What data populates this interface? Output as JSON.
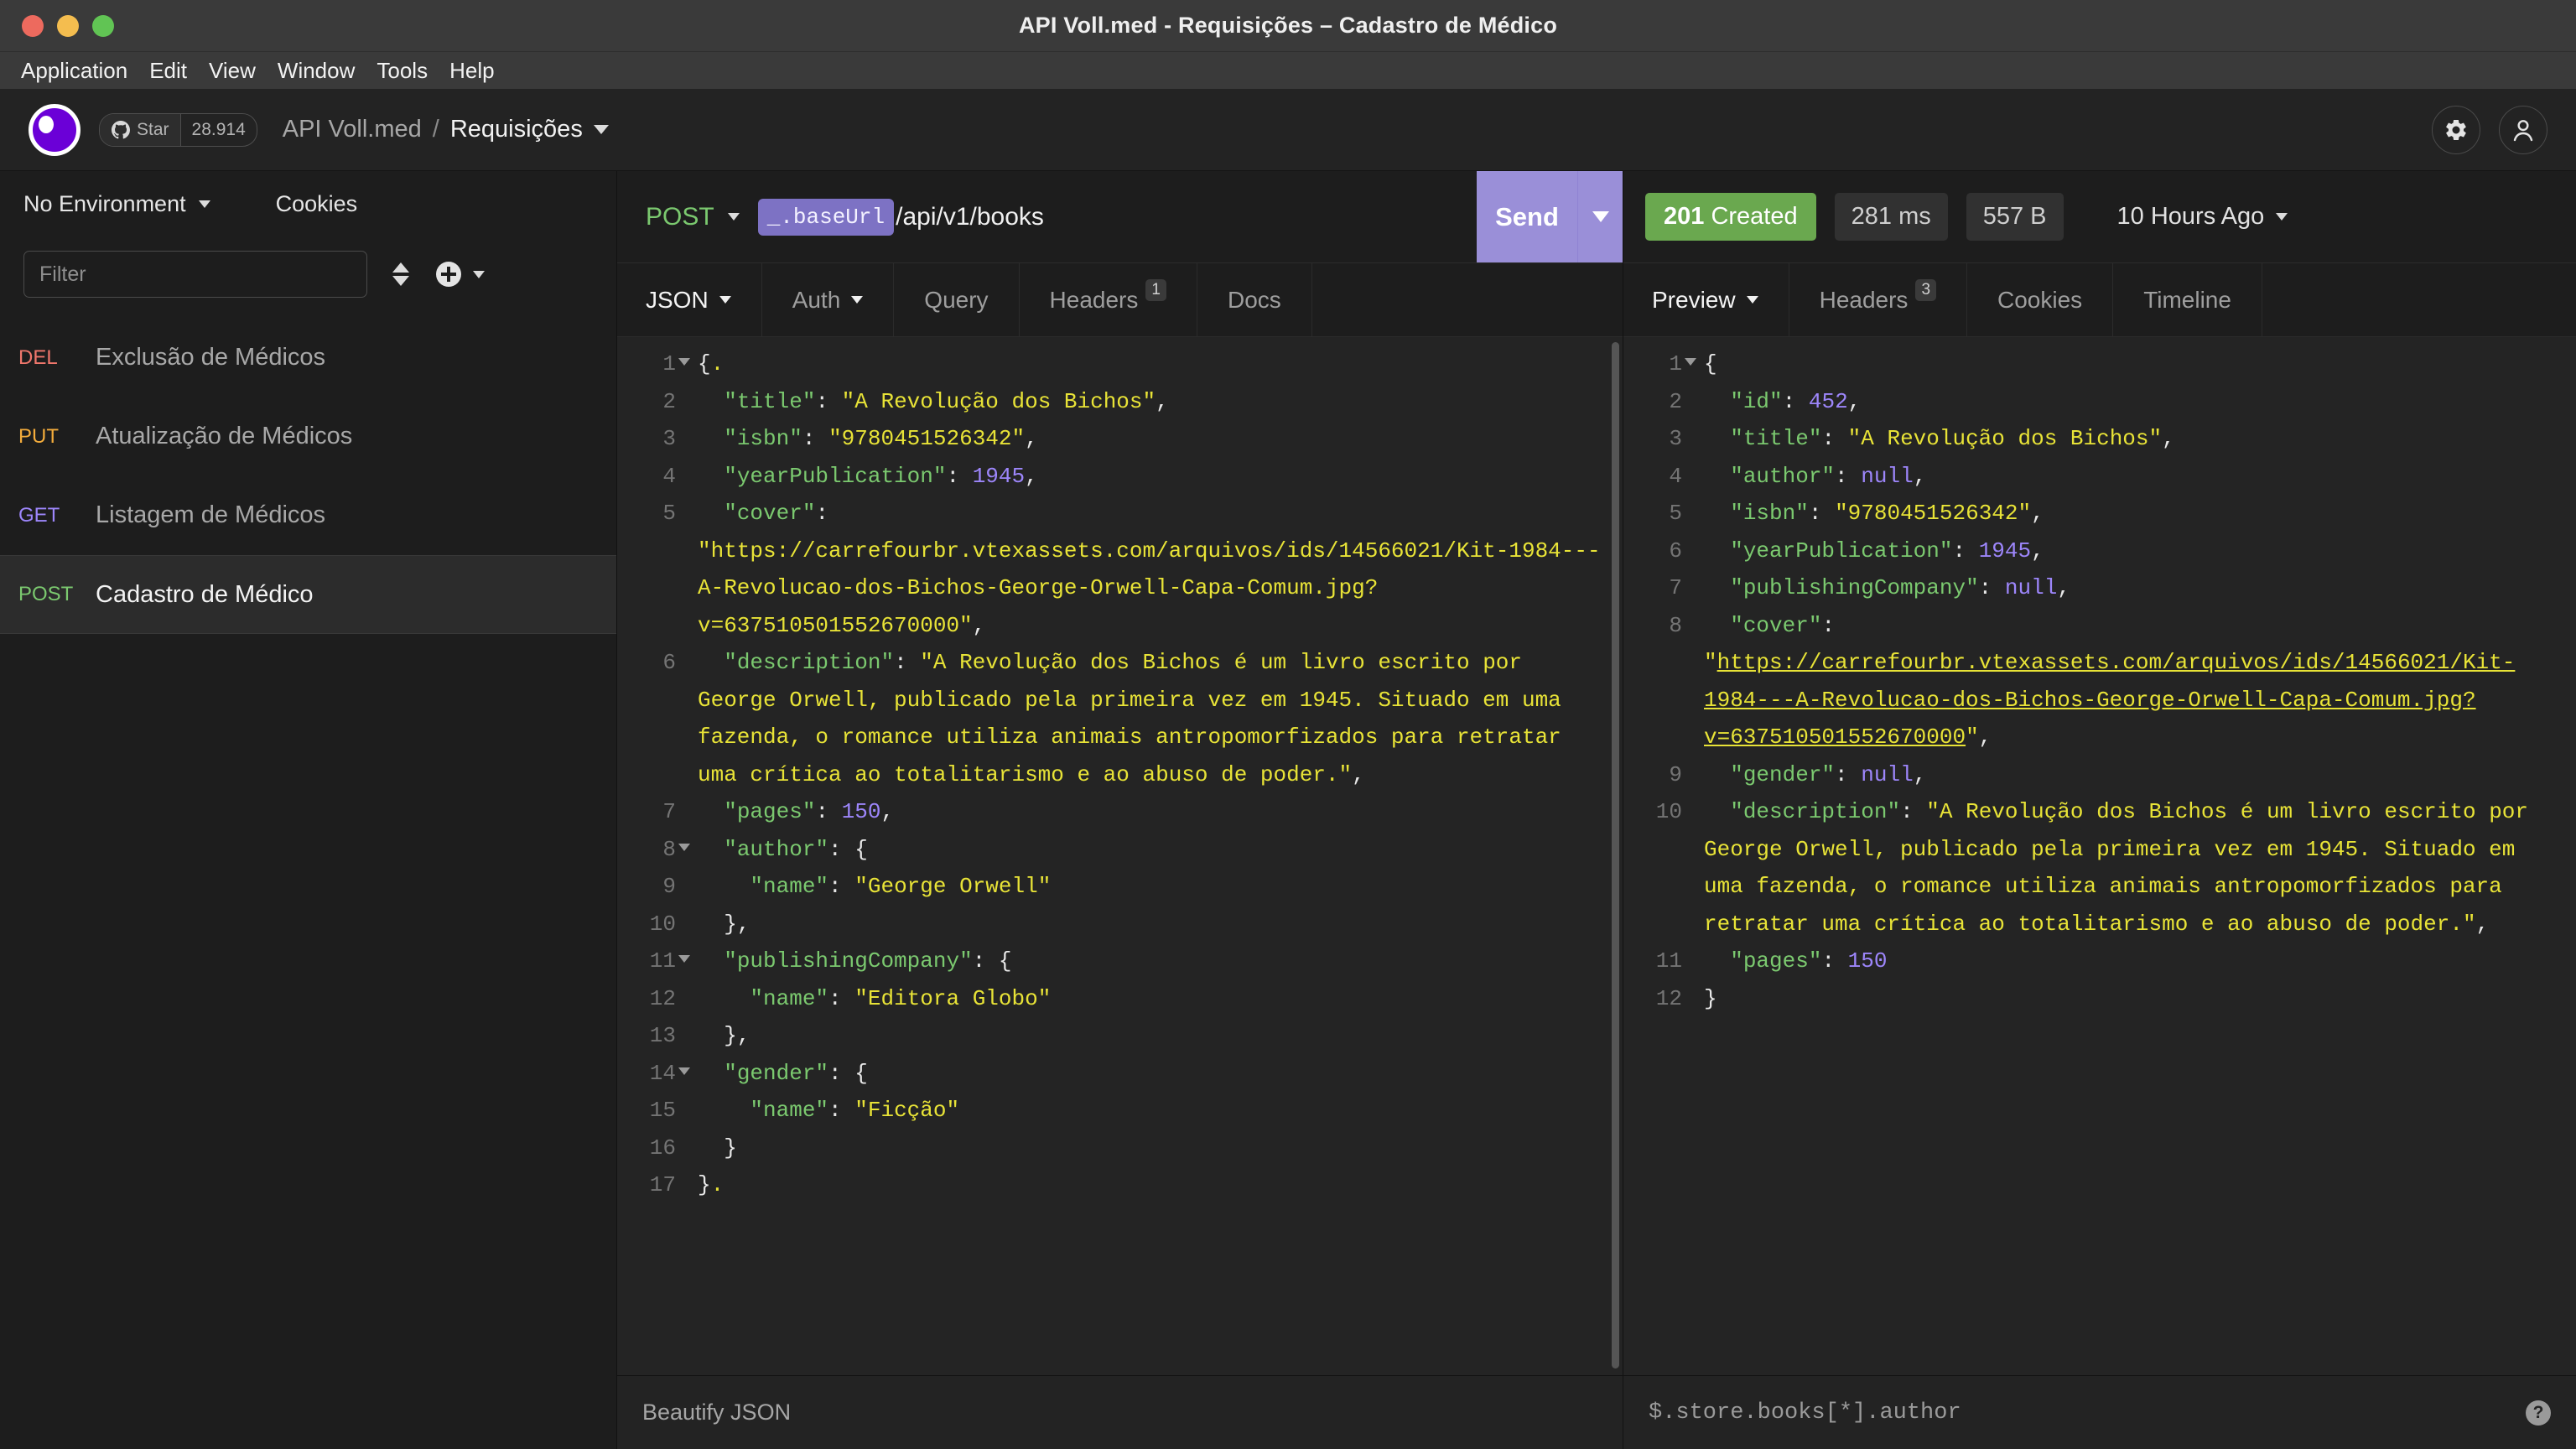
{
  "window": {
    "title": "API Voll.med - Requisições – Cadastro de Médico",
    "traffic_lights": [
      "close",
      "minimize",
      "maximize"
    ]
  },
  "menubar": {
    "items": [
      "Application",
      "Edit",
      "View",
      "Window",
      "Tools",
      "Help"
    ]
  },
  "header": {
    "star_label": "Star",
    "star_count": "28.914",
    "workspace": "API Voll.med",
    "separator": "/",
    "current": "Requisições",
    "settings_icon": "gear-icon",
    "account_icon": "user-icon"
  },
  "sidebar": {
    "environment": "No Environment",
    "cookies": "Cookies",
    "filter_placeholder": "Filter",
    "requests": [
      {
        "method": "DEL",
        "name": "Exclusão de Médicos",
        "active": false
      },
      {
        "method": "PUT",
        "name": "Atualização de Médicos",
        "active": false
      },
      {
        "method": "GET",
        "name": "Listagem de Médicos",
        "active": false
      },
      {
        "method": "POST",
        "name": "Cadastro de Médico",
        "active": true
      }
    ]
  },
  "request": {
    "method": "POST",
    "url_variable": "_.baseUrl",
    "url_path": "/api/v1/books",
    "send_label": "Send",
    "tabs": [
      {
        "label": "JSON",
        "caret": true,
        "badge": "",
        "selected": true
      },
      {
        "label": "Auth",
        "caret": true,
        "badge": "",
        "selected": false
      },
      {
        "label": "Query",
        "caret": false,
        "badge": "",
        "selected": false
      },
      {
        "label": "Headers",
        "caret": false,
        "badge": "1",
        "selected": false
      },
      {
        "label": "Docs",
        "caret": false,
        "badge": "",
        "selected": false
      }
    ],
    "footer_action": "Beautify JSON",
    "body_lines": [
      {
        "n": "1",
        "fold": true,
        "html": "<span class=\"p\">{</span><span class=\"caretpt\">.</span>"
      },
      {
        "n": "2",
        "fold": false,
        "html": "&nbsp;&nbsp;<span class=\"k\">\"title\"</span><span class=\"p\">:</span> <span class=\"s\">\"A Revolução dos Bichos\"</span><span class=\"p\">,</span>"
      },
      {
        "n": "3",
        "fold": false,
        "html": "&nbsp;&nbsp;<span class=\"k\">\"isbn\"</span><span class=\"p\">:</span> <span class=\"s\">\"9780451526342\"</span><span class=\"p\">,</span>"
      },
      {
        "n": "4",
        "fold": false,
        "html": "&nbsp;&nbsp;<span class=\"k\">\"yearPublication\"</span><span class=\"p\">:</span> <span class=\"n\">1945</span><span class=\"p\">,</span>"
      },
      {
        "n": "5",
        "fold": false,
        "html": "&nbsp;&nbsp;<span class=\"k\">\"cover\"</span><span class=\"p\">:</span> <span class=\"s\">\"https://carrefourbr.vtexassets.com/arquivos/ids/14566021/Kit-1984---A-Revolucao-dos-Bichos-George-Orwell-Capa-Comum.jpg?v=637510501552670000\"</span><span class=\"p\">,</span>"
      },
      {
        "n": "6",
        "fold": false,
        "html": "&nbsp;&nbsp;<span class=\"k\">\"description\"</span><span class=\"p\">:</span> <span class=\"s\">\"A Revolução dos Bichos é um livro escrito por George Orwell, publicado pela primeira vez em 1945. Situado em uma fazenda, o romance utiliza animais antropomorfizados para retratar uma crítica ao totalitarismo e ao abuso de poder.\"</span><span class=\"p\">,</span>"
      },
      {
        "n": "7",
        "fold": false,
        "html": "&nbsp;&nbsp;<span class=\"k\">\"pages\"</span><span class=\"p\">:</span> <span class=\"n\">150</span><span class=\"p\">,</span>"
      },
      {
        "n": "8",
        "fold": true,
        "html": "&nbsp;&nbsp;<span class=\"k\">\"author\"</span><span class=\"p\">: {</span>"
      },
      {
        "n": "9",
        "fold": false,
        "html": "&nbsp;&nbsp;&nbsp;&nbsp;<span class=\"k\">\"name\"</span><span class=\"p\">:</span> <span class=\"s\">\"George Orwell\"</span>"
      },
      {
        "n": "10",
        "fold": false,
        "html": "&nbsp;&nbsp;<span class=\"p\">},</span>"
      },
      {
        "n": "11",
        "fold": true,
        "html": "&nbsp;&nbsp;<span class=\"k\">\"publishingCompany\"</span><span class=\"p\">: {</span>"
      },
      {
        "n": "12",
        "fold": false,
        "html": "&nbsp;&nbsp;&nbsp;&nbsp;<span class=\"k\">\"name\"</span><span class=\"p\">:</span> <span class=\"s\">\"Editora Globo\"</span>"
      },
      {
        "n": "13",
        "fold": false,
        "html": "&nbsp;&nbsp;<span class=\"p\">},</span>"
      },
      {
        "n": "14",
        "fold": true,
        "html": "&nbsp;&nbsp;<span class=\"k\">\"gender\"</span><span class=\"p\">: {</span>"
      },
      {
        "n": "15",
        "fold": false,
        "html": "&nbsp;&nbsp;&nbsp;&nbsp;<span class=\"k\">\"name\"</span><span class=\"p\">:</span> <span class=\"s\">\"Ficção\"</span>"
      },
      {
        "n": "16",
        "fold": false,
        "html": "&nbsp;&nbsp;<span class=\"p\">}</span>"
      },
      {
        "n": "17",
        "fold": false,
        "html": "<span class=\"p\">}</span><span class=\"caretpt\">.</span>"
      }
    ],
    "body_json": {
      "title": "A Revolução dos Bichos",
      "isbn": "9780451526342",
      "yearPublication": 1945,
      "cover": "https://carrefourbr.vtexassets.com/arquivos/ids/14566021/Kit-1984---A-Revolucao-dos-Bichos-George-Orwell-Capa-Comum.jpg?v=637510501552670000",
      "description": "A Revolução dos Bichos é um livro escrito por George Orwell, publicado pela primeira vez em 1945. Situado em uma fazenda, o romance utiliza animais antropomorfizados para retratar uma crítica ao totalitarismo e ao abuso de poder.",
      "pages": 150,
      "author": {
        "name": "George Orwell"
      },
      "publishingCompany": {
        "name": "Editora Globo"
      },
      "gender": {
        "name": "Ficção"
      }
    }
  },
  "response": {
    "status_code": "201",
    "status_text": "Created",
    "duration": "281 ms",
    "size": "557 B",
    "time_ago": "10 Hours Ago",
    "tabs": [
      {
        "label": "Preview",
        "caret": true,
        "badge": "",
        "selected": true
      },
      {
        "label": "Headers",
        "caret": false,
        "badge": "3",
        "selected": false
      },
      {
        "label": "Cookies",
        "caret": false,
        "badge": "",
        "selected": false
      },
      {
        "label": "Timeline",
        "caret": false,
        "badge": "",
        "selected": false
      }
    ],
    "jsonpath_placeholder": "$.store.books[*].author",
    "help_icon": "question-mark-icon",
    "body_lines": [
      {
        "n": "1",
        "fold": true,
        "html": "<span class=\"p\">{</span>"
      },
      {
        "n": "2",
        "fold": false,
        "html": "&nbsp;&nbsp;<span class=\"k\">\"id\"</span><span class=\"p\">:</span> <span class=\"n\">452</span><span class=\"p\">,</span>"
      },
      {
        "n": "3",
        "fold": false,
        "html": "&nbsp;&nbsp;<span class=\"k\">\"title\"</span><span class=\"p\">:</span> <span class=\"s\">\"A Revolução dos Bichos\"</span><span class=\"p\">,</span>"
      },
      {
        "n": "4",
        "fold": false,
        "html": "&nbsp;&nbsp;<span class=\"k\">\"author\"</span><span class=\"p\">:</span> <span class=\"n\">null</span><span class=\"p\">,</span>"
      },
      {
        "n": "5",
        "fold": false,
        "html": "&nbsp;&nbsp;<span class=\"k\">\"isbn\"</span><span class=\"p\">:</span> <span class=\"s\">\"9780451526342\"</span><span class=\"p\">,</span>"
      },
      {
        "n": "6",
        "fold": false,
        "html": "&nbsp;&nbsp;<span class=\"k\">\"yearPublication\"</span><span class=\"p\">:</span> <span class=\"n\">1945</span><span class=\"p\">,</span>"
      },
      {
        "n": "7",
        "fold": false,
        "html": "&nbsp;&nbsp;<span class=\"k\">\"publishingCompany\"</span><span class=\"p\">:</span> <span class=\"n\">null</span><span class=\"p\">,</span>"
      },
      {
        "n": "8",
        "fold": false,
        "html": "&nbsp;&nbsp;<span class=\"k\">\"cover\"</span><span class=\"p\">:</span> <span class=\"s\">\"</span><span class=\"u\">https://carrefourbr.vtexassets.com/arquivos/ids/14566021/Kit-1984---A-Revolucao-dos-Bichos-George-Orwell-Capa-Comum.jpg?v=637510501552670000</span><span class=\"s\">\"</span><span class=\"p\">,</span>"
      },
      {
        "n": "9",
        "fold": false,
        "html": "&nbsp;&nbsp;<span class=\"k\">\"gender\"</span><span class=\"p\">:</span> <span class=\"n\">null</span><span class=\"p\">,</span>"
      },
      {
        "n": "10",
        "fold": false,
        "html": "&nbsp;&nbsp;<span class=\"k\">\"description\"</span><span class=\"p\">:</span> <span class=\"s\">\"A Revolução dos Bichos é um livro escrito por George Orwell, publicado pela primeira vez em 1945. Situado em uma fazenda, o romance utiliza animais antropomorfizados para retratar uma crítica ao totalitarismo e ao abuso de poder.\"</span><span class=\"p\">,</span>"
      },
      {
        "n": "11",
        "fold": false,
        "html": "&nbsp;&nbsp;<span class=\"k\">\"pages\"</span><span class=\"p\">:</span> <span class=\"n\">150</span>"
      },
      {
        "n": "12",
        "fold": false,
        "html": "<span class=\"p\">}</span>"
      }
    ],
    "body_json": {
      "id": 452,
      "title": "A Revolução dos Bichos",
      "author": null,
      "isbn": "9780451526342",
      "yearPublication": 1945,
      "publishingCompany": null,
      "cover": "https://carrefourbr.vtexassets.com/arquivos/ids/14566021/Kit-1984---A-Revolucao-dos-Bichos-George-Orwell-Capa-Comum.jpg?v=637510501552670000",
      "gender": null,
      "description": "A Revolução dos Bichos é um livro escrito por George Orwell, publicado pela primeira vez em 1945. Situado em uma fazenda, o romance utiliza animais antropomorfizados para retratar uma crítica ao totalitarismo e ao abuso de poder.",
      "pages": 150
    }
  },
  "colors": {
    "accent_purple": "#6b00d7",
    "send_button": "#9a8fd8",
    "status_success": "#6aa84f",
    "method_post": "#7bc96f",
    "method_get": "#9d86fb",
    "method_put": "#f3ac3c",
    "method_del": "#f0776c",
    "json_key": "#7bc96f",
    "json_string": "#e8e337",
    "json_number": "#9d86fb"
  }
}
